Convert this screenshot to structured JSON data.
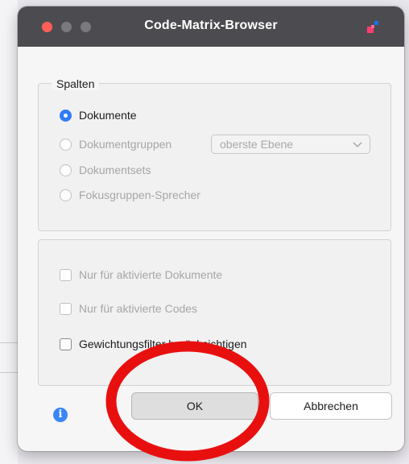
{
  "window": {
    "title": "Code-Matrix-Browser"
  },
  "columns_group": {
    "title": "Spalten",
    "options": [
      {
        "label": "Dokumente",
        "selected": true,
        "enabled": true
      },
      {
        "label": "Dokumentgruppen",
        "selected": false,
        "enabled": false
      },
      {
        "label": "Dokumentsets",
        "selected": false,
        "enabled": false
      },
      {
        "label": "Fokusgruppen-Sprecher",
        "selected": false,
        "enabled": false
      }
    ],
    "level_select": {
      "value": "oberste Ebene",
      "enabled": false
    }
  },
  "options_group": {
    "checkboxes": [
      {
        "label": "Nur für aktivierte Dokumente",
        "checked": false,
        "enabled": false
      },
      {
        "label": "Nur für aktivierte Codes",
        "checked": false,
        "enabled": false
      },
      {
        "label": "Gewichtungsfilter berücksichtigen",
        "checked": false,
        "enabled": true
      }
    ]
  },
  "footer": {
    "info_icon": "info-icon",
    "ok_label": "OK",
    "cancel_label": "Abbrechen"
  },
  "colors": {
    "accent": "#2f7cf6",
    "annotation_circle": "#e8100f",
    "titlebar": "#4c4c50"
  }
}
